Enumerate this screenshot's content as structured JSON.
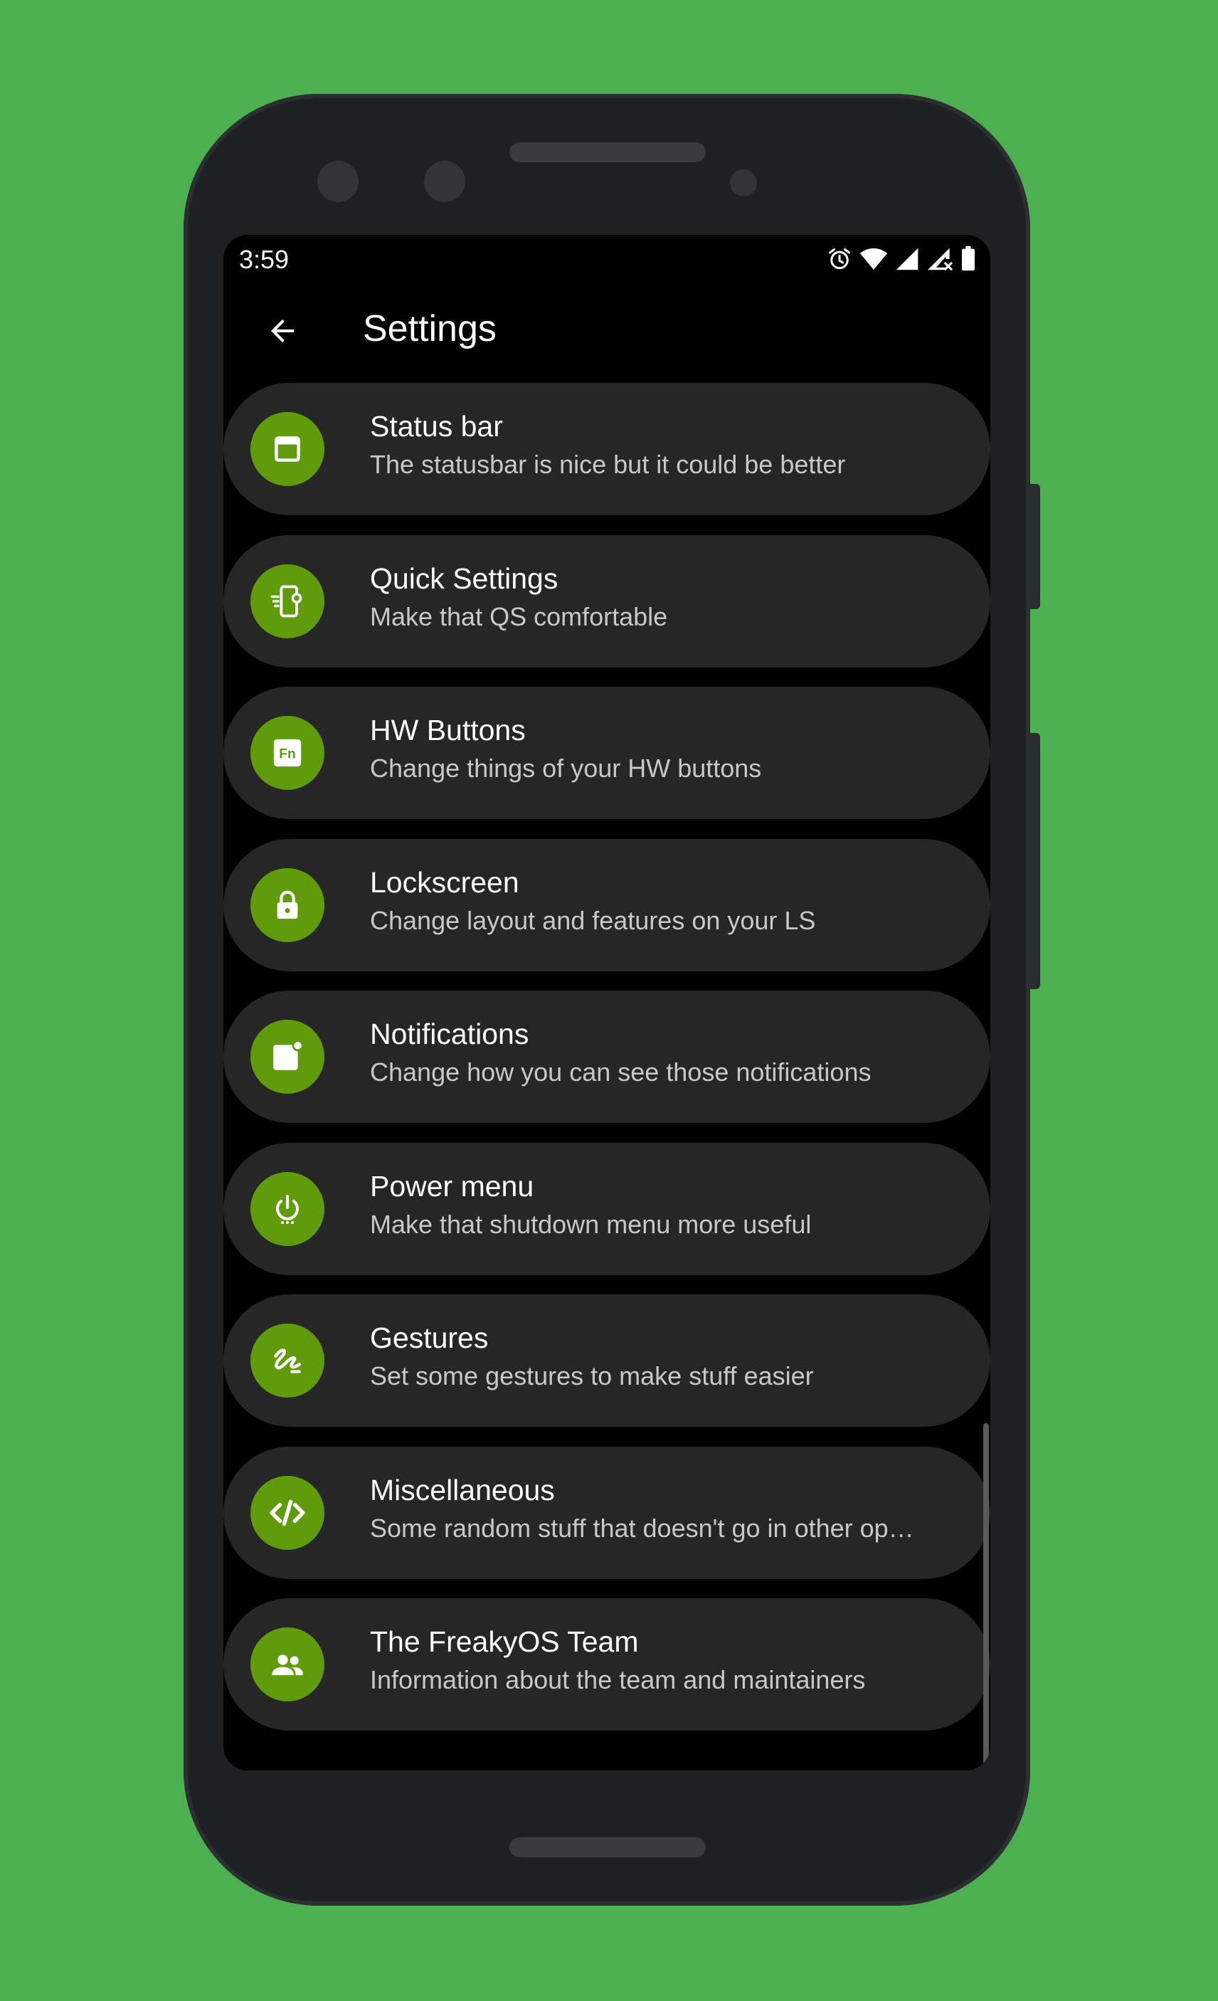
{
  "status_bar": {
    "time": "3:59",
    "icons": [
      "alarm-icon",
      "wifi-icon",
      "signal-icon",
      "signal-no-data-icon",
      "battery-icon"
    ]
  },
  "toolbar": {
    "title": "Settings",
    "back_icon": "arrow-left-icon"
  },
  "colors": {
    "background": "#4caf50",
    "accent": "#5f9b0a",
    "card": "#262626",
    "screen": "#000000"
  },
  "items": [
    {
      "title": "Status bar",
      "subtitle": "The statusbar is nice but it could be better",
      "icon": "status-bar-icon"
    },
    {
      "title": "Quick Settings",
      "subtitle": "Make that QS comfortable",
      "icon": "quick-settings-icon"
    },
    {
      "title": "HW Buttons",
      "subtitle": "Change things of your HW buttons",
      "icon": "fn-key-icon"
    },
    {
      "title": "Lockscreen",
      "subtitle": "Change layout and features on your LS",
      "icon": "lock-icon"
    },
    {
      "title": "Notifications",
      "subtitle": "Change how you can see those notifications",
      "icon": "notification-icon"
    },
    {
      "title": "Power menu",
      "subtitle": "Make that shutdown menu more useful",
      "icon": "power-icon"
    },
    {
      "title": "Gestures",
      "subtitle": "Set some gestures to make stuff easier",
      "icon": "gesture-icon"
    },
    {
      "title": "Miscellaneous",
      "subtitle": "Some random stuff that doesn't go in other op…",
      "icon": "code-icon"
    },
    {
      "title": "The FreakyOS Team",
      "subtitle": "Information about the team and maintainers",
      "icon": "people-icon"
    }
  ],
  "hw_icon_text": "Fn"
}
